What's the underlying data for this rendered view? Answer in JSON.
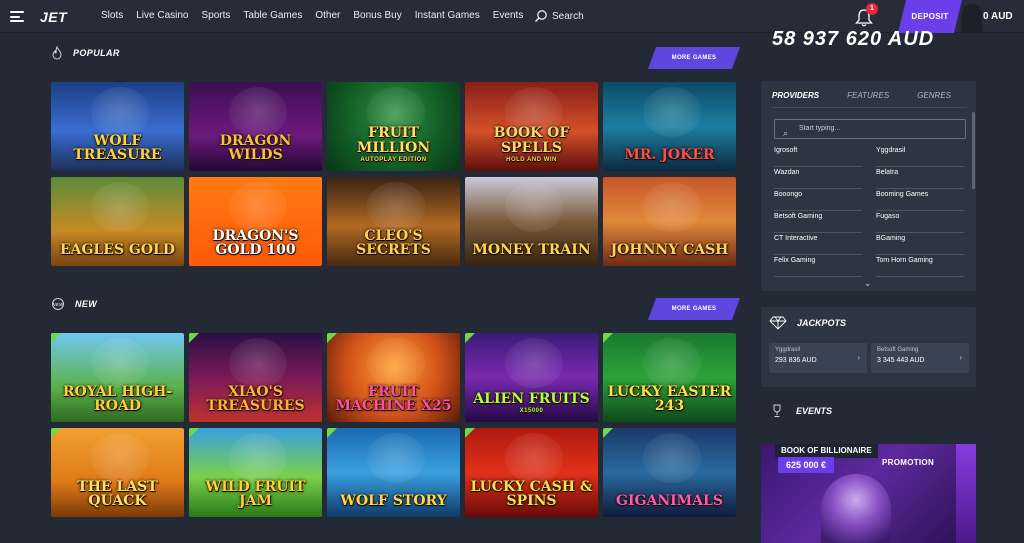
{
  "header": {
    "logo": "JET",
    "nav": [
      "Slots",
      "Live Casino",
      "Sports",
      "Table Games",
      "Other",
      "Bonus Buy",
      "Instant Games",
      "Events"
    ],
    "search_label": "Search",
    "notification_count": "1",
    "deposit_label": "DEPOSIT",
    "balance": "0 AUD"
  },
  "sections": {
    "popular": {
      "title": "POPULAR",
      "more_label": "MORE GAMES",
      "games": [
        {
          "title": "Wolf Treasure",
          "sub": "",
          "bg": "linear-gradient(180deg,#1c3f86 0%,#3a6ed1 55%,#1d2f5a 100%)",
          "fg": "#ffd23f"
        },
        {
          "title": "Dragon Wilds",
          "sub": "",
          "bg": "linear-gradient(180deg,#3b0f52 0%,#6d1a7d 60%,#240836 100%)",
          "fg": "#f7c23c"
        },
        {
          "title": "Fruit Million",
          "sub": "Autoplay Edition",
          "bg": "radial-gradient(circle at 50% 40%,#2e8f3f 0%,#115a25 60%,#0a3517 100%)",
          "fg": "#ffe066"
        },
        {
          "title": "Book of Spells",
          "sub": "HOLD AND WIN",
          "bg": "linear-gradient(180deg,#8a1d16 0%,#d3512a 55%,#5d0e0b 100%)",
          "fg": "#ffd86b"
        },
        {
          "title": "Mr. Joker",
          "sub": "",
          "bg": "linear-gradient(180deg,#0d4a66 0%,#1c7fa0 50%,#0a2a3f 100%)",
          "fg": "#ff4d4d"
        },
        {
          "title": "Eagles Gold",
          "sub": "",
          "bg": "linear-gradient(180deg,#5b8d3a 0%,#c68a24 60%,#7a4410 100%)",
          "fg": "#ffd55a"
        },
        {
          "title": "Dragon's Gold 100",
          "sub": "",
          "bg": "linear-gradient(180deg,#ff7a12 0%,#ff5a08 100%)",
          "fg": "#ffffff"
        },
        {
          "title": "Cleo's Secrets",
          "sub": "",
          "bg": "linear-gradient(180deg,#3c2212 0%,#b06a24 55%,#4a2a10 100%)",
          "fg": "#ffcf5a"
        },
        {
          "title": "Money Train",
          "sub": "",
          "bg": "linear-gradient(180deg,#c9c9d9 0%,#7a5a38 50%,#3a2212 100%)",
          "fg": "#ffd94a"
        },
        {
          "title": "Johnny Cash",
          "sub": "",
          "bg": "linear-gradient(180deg,#c8572a 0%,#e1893a 50%,#6e2a14 100%)",
          "fg": "#ffd35a"
        }
      ]
    },
    "new": {
      "title": "NEW",
      "more_label": "MORE GAMES",
      "games": [
        {
          "title": "Royal High-Road",
          "sub": "",
          "bg": "linear-gradient(180deg,#6fc7f0 0%,#5cb24a 60%,#2f6a22 100%)",
          "fg": "#ffd13a"
        },
        {
          "title": "Xiao's Treasures",
          "sub": "",
          "bg": "linear-gradient(180deg,#2a0f45 0%,#7a1a58 50%,#c0322e 100%)",
          "fg": "#ffb13a"
        },
        {
          "title": "Fruit Machine x25",
          "sub": "",
          "bg": "radial-gradient(circle at 50% 40%,#ff9b2a 0%,#d1521a 55%,#5a1a08 100%)",
          "fg": "#ff4fa0"
        },
        {
          "title": "Alien Fruits",
          "sub": "X15000",
          "bg": "linear-gradient(180deg,#3a1a78 0%,#7a2ab0 50%,#220a44 100%)",
          "fg": "#b6ff3a"
        },
        {
          "title": "Lucky Easter 243",
          "sub": "",
          "bg": "linear-gradient(180deg,#1a7a2e 0%,#2ea23a 50%,#0f4a1a 100%)",
          "fg": "#ffe14a"
        },
        {
          "title": "The Last Quack",
          "sub": "",
          "bg": "linear-gradient(180deg,#f0a030 0%,#e07a18 60%,#7a3a08 100%)",
          "fg": "#ffe36a"
        },
        {
          "title": "Wild Fruit Jam",
          "sub": "",
          "bg": "linear-gradient(180deg,#3aa0e0 0%,#7ad04a 55%,#2a7a1a 100%)",
          "fg": "#ffd23a"
        },
        {
          "title": "Wolf Story",
          "sub": "",
          "bg": "linear-gradient(180deg,#1a6ab0 0%,#3aa0e0 50%,#0f3a6a 100%)",
          "fg": "#ffd84a"
        },
        {
          "title": "Lucky Cash & Spins",
          "sub": "",
          "bg": "linear-gradient(180deg,#b0180f 0%,#e0321a 50%,#6a0a08 100%)",
          "fg": "#ffe14a"
        },
        {
          "title": "Giganimals",
          "sub": "",
          "bg": "linear-gradient(180deg,#1a3a6a 0%,#2a6aa0 50%,#0f1a3a 100%)",
          "fg": "#ff5ab0"
        }
      ]
    }
  },
  "right_panel": {
    "jackpot_total": "58 937 620 AUD",
    "tabs": [
      "PROVIDERS",
      "FEATURES",
      "GENRES"
    ],
    "search_placeholder": "Start typing...",
    "providers": [
      "Igrosoft",
      "Yggdrasil",
      "Wazdan",
      "Belatra",
      "Booongo",
      "Booming Games",
      "Betsoft Gaming",
      "Fugaso",
      "CT Interactive",
      "BGaming",
      "Felix Gaming",
      "Tom Horn Gaming"
    ],
    "jackpots": {
      "title": "JACKPOTS",
      "items": [
        {
          "name": "Yggdrasil",
          "amount": "293 836 AUD"
        },
        {
          "name": "Betsoft Gaming",
          "amount": "3 345 443 AUD"
        }
      ]
    },
    "events": {
      "title": "EVENTS",
      "promo_title": "BOOK OF BILLIONAIRE",
      "promo_amount": "625 000 €",
      "promo_tag": "PROMOTION"
    }
  },
  "colors": {
    "background": "#232a35",
    "accent": "#6a3ee8",
    "panel": "#2d3542",
    "badge": "#e32a3c",
    "new_corner": "#6dd84a"
  }
}
